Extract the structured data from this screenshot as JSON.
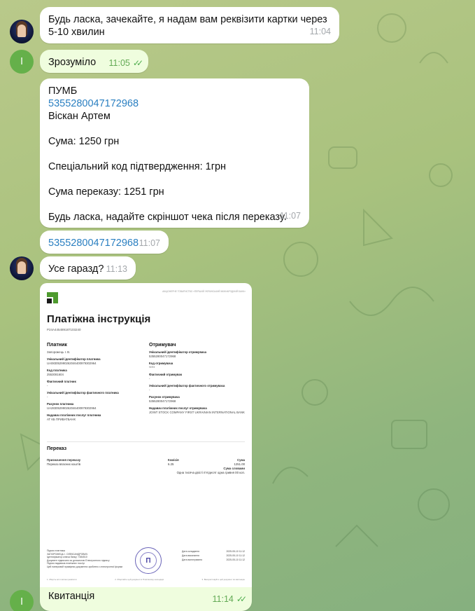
{
  "colors": {
    "link": "#2a7fc1",
    "outgoing_bubble": "#effdde",
    "incoming_bubble": "#ffffff",
    "read_ticks": "#4fae4e"
  },
  "avatars": {
    "sender_initial": "I"
  },
  "messages": [
    {
      "text": "Будь ласка, зачекайте, я надам вам реквізити картки через 5-10 хвилин",
      "time": "11:04"
    },
    {
      "text": "Зрозуміло",
      "time": "11:05"
    },
    {
      "bank": "ПУМБ",
      "card": "5355280047172968",
      "name": "Віскан Артем",
      "sum": "Сума: 1250 грн",
      "code": "Спеціальний код підтвердження: 1грн",
      "total": "Сума переказу: 1251 грн",
      "request": "Будь ласка, надайте скріншот чека після переказу.",
      "time": "11:07"
    },
    {
      "card": "5355280047172968",
      "time": "11:07"
    },
    {
      "text": "Усе гаразд?",
      "time": "11:13"
    },
    {
      "caption": "Квитанція",
      "time": "11:14"
    }
  ],
  "receipt": {
    "header_right": "АКЦІОНЕРНЕ ТОВАРИСТВО «ПЕРШИЙ УКРАЇНСЬКИЙ МІЖНАРОДНИЙ БАНК»",
    "title": "Платіжна інструкція",
    "doc_number": "P24A445489187103240",
    "payer": {
      "heading": "Платник",
      "name": "Запорожець І. В.",
      "fields": [
        {
          "label": "Унікальний ідентифікатор платника",
          "value": "UA083052990262046400979302964"
        },
        {
          "label": "Код платника",
          "value": "2553081604"
        },
        {
          "label": "Фактичний платник",
          "value": "-"
        },
        {
          "label": "Унікальний ідентифікатор фактичного платника",
          "value": "-"
        },
        {
          "label": "Рахунок платника",
          "value": "UA283052990262046400979302964"
        },
        {
          "label": "Надавач платіжних послуг платника",
          "value": "АТ КБ ПРИВАТБАНК"
        }
      ]
    },
    "payee": {
      "heading": "Отримувач",
      "name": "",
      "fields": [
        {
          "label": "Унікальний ідентифікатор отримувача",
          "value": "5355280047172968"
        },
        {
          "label": "Код отримувача",
          "value": "*****"
        },
        {
          "label": "Фактичний отримувач",
          "value": "-"
        },
        {
          "label": "Унікальний ідентифікатор фактичного отримувача",
          "value": "-"
        },
        {
          "label": "Рахунок отримувача",
          "value": "5355280047172968"
        },
        {
          "label": "Надавач платіжних послуг отримувача",
          "value": "JOINT STOCK COMPANY FIRST UKRAINIAN INTERNATIONAL BANK"
        }
      ]
    },
    "transfer": {
      "heading": "Переказ",
      "purpose_label": "Призначення переказу",
      "purpose_value": "Переказ власних коштів",
      "commission_label": "Комісія",
      "commission_value": "6.25",
      "sum_label": "Сума",
      "sum_value": "1251.00",
      "words_label": "Сума словами",
      "words_value": "Одна тисяча двісті п'ятдесят одна гривня 00 коп."
    },
    "footer_left": "Підпис платника\nЗАПОРОЖЕЦЬ І. ОЛЕКСАНДРОВИЧ\nІдентифікатор ключа банку: 7384510\nДокумент підписано за допомогою Електронного підпису\nПідпис надавача платіжних послуг\nЦей паперовий примірник документа зроблено з електронної форми",
    "dates": [
      {
        "label": "Дата складання",
        "value": "2025-05-10 11:12"
      },
      {
        "label": "Дата виконання",
        "value": "2025-05-10 11:12"
      },
      {
        "label": "Дата валютування",
        "value": "2025-05-10 11:12"
      }
    ],
    "footnotes": [
      "1. Зберіть всі платіжні реквізити",
      "2. Зберігайте цей документ в Платіжному календарі",
      "3. Використовуйте цей документ як квитанцію"
    ]
  }
}
